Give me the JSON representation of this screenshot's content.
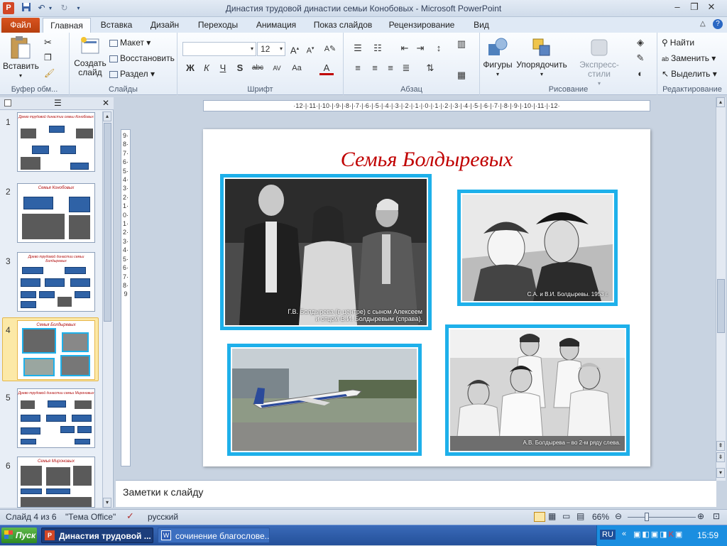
{
  "window": {
    "title": "Династия трудовой династии семьи Конобовых - Microsoft PowerPoint"
  },
  "tabs": {
    "file": "Файл",
    "home": "Главная",
    "insert": "Вставка",
    "design": "Дизайн",
    "transitions": "Переходы",
    "animation": "Анимация",
    "slideshow": "Показ слайдов",
    "review": "Рецензирование",
    "view": "Вид"
  },
  "ribbon": {
    "clipboard": {
      "paste": "Вставить",
      "label": "Буфер обм..."
    },
    "slides": {
      "new_slide_1": "Создать",
      "new_slide_2": "слайд",
      "layout": "Макет",
      "reset": "Восстановить",
      "section": "Раздел",
      "label": "Слайды"
    },
    "font": {
      "size": "12",
      "label": "Шрифт"
    },
    "paragraph": {
      "label": "Абзац"
    },
    "drawing": {
      "shapes": "Фигуры",
      "arrange": "Упорядочить",
      "styles": "Экспресс-стили",
      "label": "Рисование"
    },
    "editing": {
      "find": "Найти",
      "replace": "Заменить",
      "select": "Выделить",
      "label": "Редактирование"
    }
  },
  "ruler": {
    "h": "·12·|·11·|·10·|·9·|·8·|·7·|·6·|·5·|·4·|·3·|·2·|·1·|·0·|·1·|·2·|·3·|·4·|·5·|·6·|·7·|·8·|·9·|·10·|·11·|·12·",
    "v": "9·8·7·6·5·4·3·2·1·0·1·2·3·4·5·6·7·8·9"
  },
  "thumbnails": [
    {
      "num": "1",
      "title": "Древо трудовой династии семьи Конобовых"
    },
    {
      "num": "2",
      "title": "Семья Конобовых"
    },
    {
      "num": "3",
      "title": "Древо трудовой династии семьи Болдыревых"
    },
    {
      "num": "4",
      "title": "Семья Болдыревых"
    },
    {
      "num": "5",
      "title": "Древо трудовой династии семьи Мироновых"
    },
    {
      "num": "6",
      "title": "Семья Мироновых"
    }
  ],
  "slide": {
    "title": "Семья Болдыревых",
    "captions": {
      "photo1_line1": "Г.В. Болдырева (в центре) с сыном Алексеем",
      "photo1_line2": "и отцом В.И. Болдыревым (справа).",
      "photo2": "С.А. и В.И. Болдыревы. 1953 г.",
      "photo4": "А.В. Болдырева – во 2-м ряду слева."
    }
  },
  "notes": {
    "placeholder": "Заметки к слайду"
  },
  "status": {
    "slide_of": "Слайд 4 из 6",
    "theme": "\"Тема Office\"",
    "language": "русский",
    "zoom": "66%"
  },
  "taskbar": {
    "start": "Пуск",
    "task1": "Династия трудовой ...",
    "task2": "сочинение благослове...",
    "lang": "RU",
    "clock": "15:59"
  }
}
